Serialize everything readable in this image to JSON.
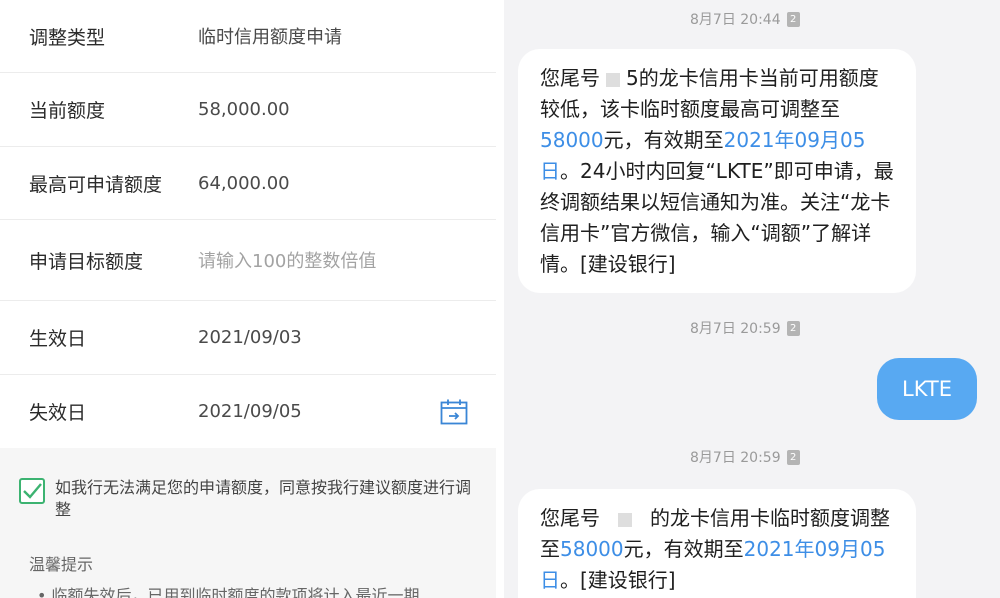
{
  "form": {
    "rows": [
      {
        "label": "调整类型",
        "value": "临时信用额度申请"
      },
      {
        "label": "当前额度",
        "value": "58,000.00"
      },
      {
        "label": "最高可申请额度",
        "value": "64,000.00"
      },
      {
        "label": "申请目标额度",
        "placeholder": "请输入100的整数倍值"
      },
      {
        "label": "生效日",
        "value": "2021/09/03"
      },
      {
        "label": "失效日",
        "value": "2021/09/05"
      }
    ],
    "agree_checked": true,
    "agree_text": "如我行无法满足您的申请额度，同意按我行建议额度进行调整",
    "tips_title": "温馨提示",
    "tips_first": "临额失效后，已用到临时额度的款项将计入最近一期"
  },
  "chat": {
    "sim_label": "2",
    "messages": [
      {
        "time": "8月7日 20:44"
      },
      {
        "time": "8月7日 20:59"
      },
      {
        "time": "8月7日 20:59"
      }
    ],
    "msg1": {
      "p1": "您尾号",
      "p1b": "5的龙卡信用卡当前可用额度较低，该卡临时额度最高可调整至",
      "amount": "58000",
      "p2": "元，有效期至",
      "date": "2021年09月05日",
      "p3": "。24小时内回复“LKTE”即可申请，最终调额结果以短信通知为准。关注“龙卡信用卡”官方微信，输入“调额”了解详情。[建设银行]"
    },
    "reply": "LKTE",
    "msg2": {
      "p1": "您尾号",
      "p1b": "的龙卡信用卡临时额度调整至",
      "amount": "58000",
      "p2": "元，有效期至",
      "date": "2021年09月05日",
      "p3": "。[建设银行]"
    }
  }
}
